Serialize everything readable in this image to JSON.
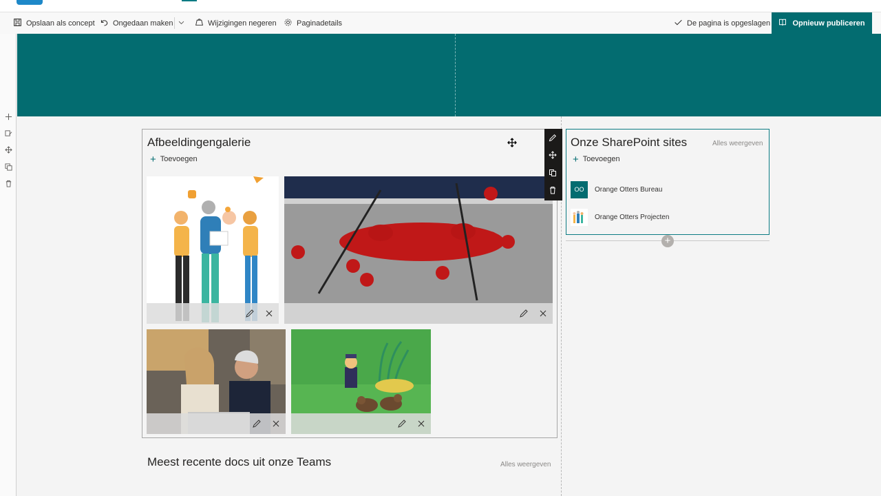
{
  "toolbar": {
    "save_draft": "Opslaan als concept",
    "undo": "Ongedaan maken",
    "discard": "Wijzigingen negeren",
    "page_details": "Paginadetails",
    "saved_status": "De pagina is opgeslagen",
    "republish": "Opnieuw publiceren"
  },
  "gallery": {
    "title": "Afbeeldingengalerie",
    "add_label": "Toevoegen"
  },
  "sites": {
    "title": "Onze SharePoint sites",
    "see_all": "Alles weergeven",
    "add_label": "Toevoegen",
    "items": [
      {
        "initials": "OO",
        "name": "Orange Otters Bureau"
      },
      {
        "initials": "",
        "name": "Orange Otters Projecten"
      }
    ]
  },
  "docs": {
    "title": "Meest recente docs uit onze Teams",
    "see_all": "Alles weergeven"
  },
  "colors": {
    "accent": "#036c70",
    "accent_border": "#0a7b83"
  }
}
